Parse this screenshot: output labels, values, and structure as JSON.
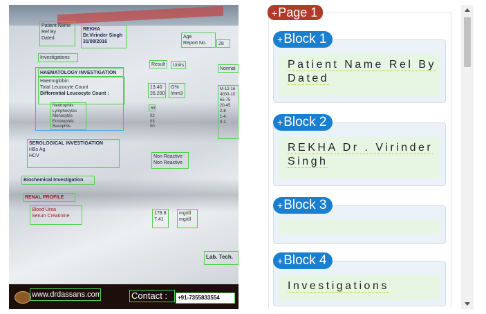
{
  "document_image": {
    "ocr_boxes": {
      "patient_labels": [
        "Patient Name",
        "Ref By",
        "Dated"
      ],
      "patient_values": [
        "REKHA",
        "Dr.Virinder Singh",
        "31/08/2016"
      ],
      "age_labels": [
        "Age",
        "Report No."
      ],
      "age_value": "28",
      "investigations": "Investigations",
      "result": "Result",
      "units": "Units",
      "normal": "Normal",
      "haematology": "HAEMATOLOGY INVESTIGATION",
      "haematology_tests": [
        "Haemoglobin",
        "Total Leucocyte Count",
        "Differential Leucocyte Count :"
      ],
      "haem_results": [
        "13.40",
        "26.200"
      ],
      "haem_units": [
        "G%",
        "/mm3"
      ],
      "differential": [
        "Neutrophils",
        "Lymphocytes",
        "Monocytes",
        "Eosinophils",
        "Basophils"
      ],
      "differential_values": [
        "68",
        "",
        "02",
        "03",
        "00"
      ],
      "normal_ranges": [
        "M-12-16",
        "4000-10",
        "65-75",
        "20-45",
        "2-8",
        "1-4",
        "0-1"
      ],
      "serological": "SEROLOGICAL INVESTIGATION",
      "sero_tests": [
        "HBs Ag",
        "HCV"
      ],
      "sero_results": [
        "Non Reactive",
        "Non Reactive"
      ],
      "biochemical": "Biochemical Investigation",
      "renal": "RENAL PROFILE",
      "renal_tests": [
        "Blood Urea",
        "Serum Creatinine"
      ],
      "renal_results": [
        "178.8",
        "7.41"
      ],
      "renal_units": [
        "mg/dl",
        "mg/dl"
      ],
      "lab_tech": "Lab. Tech.",
      "website": "www.drdassans.com",
      "contact_label": "Contact :",
      "contact_number": "+91-7355833554"
    }
  },
  "panel": {
    "page_label": "Page 1",
    "blocks": [
      {
        "label": "Block 1",
        "text": "Patient Name Rel By Dated"
      },
      {
        "label": "Block 2",
        "text": "REKHA Dr . Virinder Singh"
      },
      {
        "label": "Block 3",
        "text": ""
      },
      {
        "label": "Block 4",
        "text": "Investigations"
      }
    ]
  },
  "colors": {
    "page_badge": "#b23a2b",
    "block_badge": "#1a7fcf",
    "ocr_box": "#4fd04a",
    "ocr_box_alt": "#3fa9f5",
    "block_bg": "#eaf2f8",
    "text_bg": "#e6f6e3"
  },
  "icons": {
    "add": "plus-icon",
    "scroll_up": "scroll-up-arrow-icon",
    "scroll_down": "scroll-down-arrow-icon"
  }
}
